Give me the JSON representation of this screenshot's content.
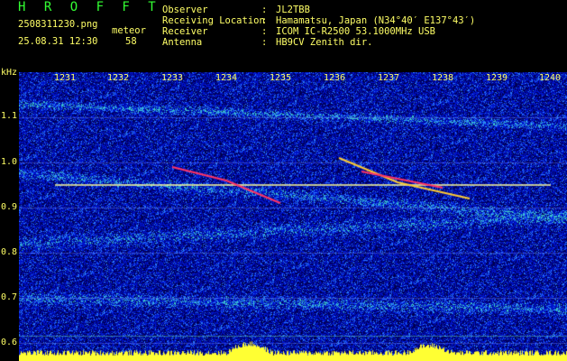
{
  "header": {
    "title": "H R O F F T",
    "filename": "2508311230.png",
    "datetime": "25.08.31 12:30",
    "meteor_label": "meteor",
    "meteor_count": "58",
    "fields": [
      {
        "label": "Observer",
        "sep": ":",
        "value": "JL2TBB"
      },
      {
        "label": "Receiving Location",
        "sep": ":",
        "value": "Hamamatsu, Japan (N34°40′ E137°43′)"
      },
      {
        "label": "Receiver",
        "sep": ":",
        "value": "ICOM IC-R2500 53.1000MHz USB"
      },
      {
        "label": "Antenna",
        "sep": ":",
        "value": "HB9CV Zenith dir."
      }
    ]
  },
  "axis": {
    "unit": "kHz",
    "x_ticks": [
      "1231",
      "1232",
      "1233",
      "1234",
      "1235",
      "1236",
      "1237",
      "1238",
      "1239",
      "1240"
    ],
    "y_ticks": [
      "1.1",
      "1.0",
      "0.9",
      "0.8",
      "0.7",
      "0.6"
    ]
  },
  "colors": {
    "background": "#000000",
    "text": "#ffff66",
    "title": "#33ff33",
    "noise_low": "#0a1a8c",
    "noise_mid": "#2255ff",
    "signal": "#ffff99",
    "meteor": "#ff3366"
  }
}
